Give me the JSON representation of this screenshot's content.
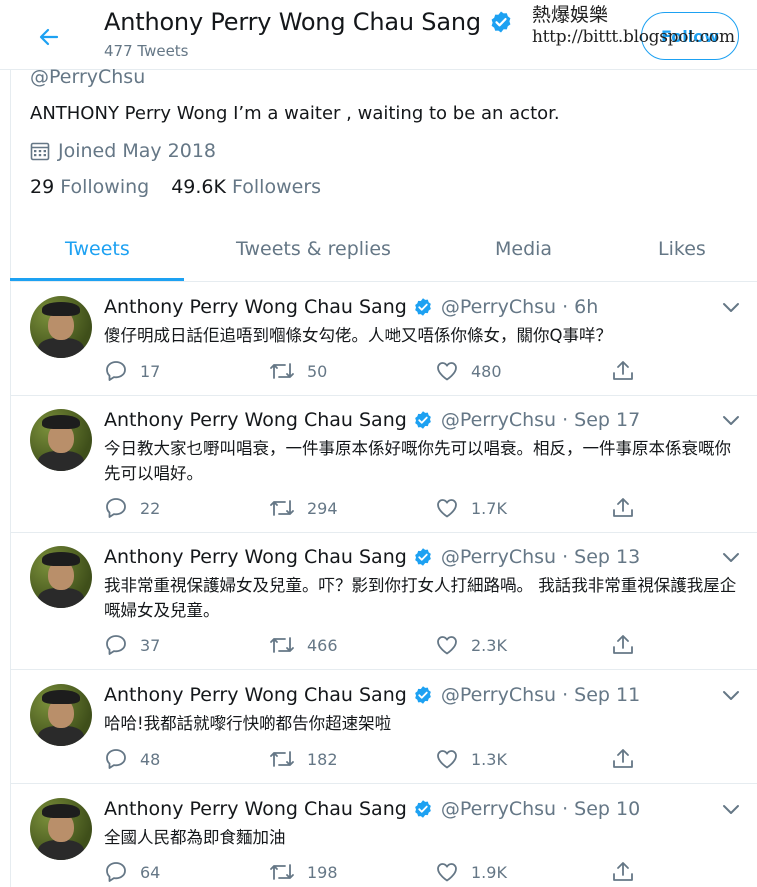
{
  "header": {
    "name": "Anthony Perry Wong Chau Sang",
    "tweet_count": "477 Tweets",
    "follow_label": "Follow",
    "watermark_title": "熱爆娛樂",
    "watermark_url": "http://bittt.blogspot.com"
  },
  "profile": {
    "handle": "@PerryChsu",
    "bio": "ANTHONY Perry Wong I’m a waiter , waiting to be an actor.",
    "joined": "Joined May 2018",
    "following_count": "29",
    "following_label": "Following",
    "followers_count": "49.6K",
    "followers_label": "Followers"
  },
  "tabs": [
    {
      "label": "Tweets",
      "active": true
    },
    {
      "label": "Tweets & replies",
      "active": false
    },
    {
      "label": "Media",
      "active": false
    },
    {
      "label": "Likes",
      "active": false
    }
  ],
  "tweets": [
    {
      "name": "Anthony Perry Wong Chau Sang",
      "meta": "@PerryChsu · 6h",
      "text": "傻仔明成日話佢追唔到嗰條女勾佬。人哋又唔係你條女，關你Q事咩？",
      "replies": "17",
      "retweets": "50",
      "likes": "480"
    },
    {
      "name": "Anthony Perry Wong Chau Sang",
      "meta": "@PerryChsu · Sep 17",
      "text": "今日教大家乜嘢叫唱衰，一件事原本係好嘅你先可以唱衰。相反，一件事原本係衰嘅你先可以唱好。",
      "replies": "22",
      "retweets": "294",
      "likes": "1.7K"
    },
    {
      "name": "Anthony Perry Wong Chau Sang",
      "meta": "@PerryChsu · Sep 13",
      "text": "我非常重視保護婦女及兒童。吓？影到你打女人打細路喎。 我話我非常重視保護我屋企嘅婦女及兒童。",
      "replies": "37",
      "retweets": "466",
      "likes": "2.3K"
    },
    {
      "name": "Anthony Perry Wong Chau Sang",
      "meta": "@PerryChsu · Sep 11",
      "text": "哈哈!我都話就嚟行快啲都告你超速架啦",
      "replies": "48",
      "retweets": "182",
      "likes": "1.3K"
    },
    {
      "name": "Anthony Perry Wong Chau Sang",
      "meta": "@PerryChsu · Sep 10",
      "text": "全國人民都為即食麵加油",
      "replies": "64",
      "retweets": "198",
      "likes": "1.9K"
    }
  ],
  "colors": {
    "accent": "#1da1f2",
    "secondary_text": "#657786",
    "primary_text": "#14171a",
    "border": "#e6ecf0"
  },
  "icons": {
    "back": "arrow-left-icon",
    "verified": "verified-badge-icon",
    "calendar": "calendar-icon",
    "reply": "reply-icon",
    "retweet": "retweet-icon",
    "like": "heart-icon",
    "share": "share-icon",
    "menu": "chevron-down-icon"
  }
}
